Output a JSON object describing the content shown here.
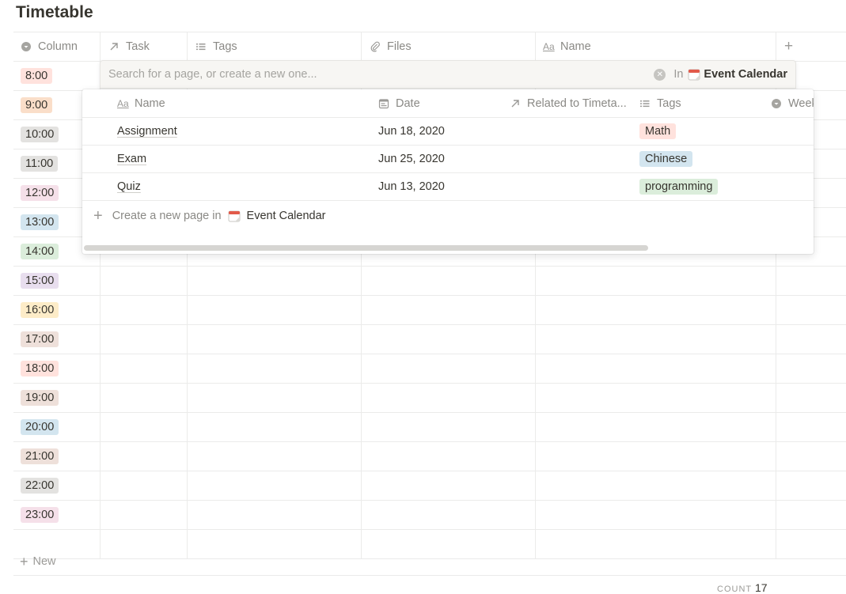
{
  "page": {
    "title": "Timetable"
  },
  "table": {
    "columns": [
      {
        "icon": "select-icon",
        "label": "Column"
      },
      {
        "icon": "relation-arrow-icon",
        "label": "Task"
      },
      {
        "icon": "list-icon",
        "label": "Tags"
      },
      {
        "icon": "paperclip-icon",
        "label": "Files"
      },
      {
        "icon": "text-aa-icon",
        "label": "Name"
      }
    ],
    "add_column": "+",
    "rows": [
      {
        "time": "8:00",
        "color": "#ffe2dd"
      },
      {
        "time": "9:00",
        "color": "#fadec9"
      },
      {
        "time": "10:00",
        "color": "#e3e2e0"
      },
      {
        "time": "11:00",
        "color": "#e3e2e0"
      },
      {
        "time": "12:00",
        "color": "#f5e0e9"
      },
      {
        "time": "13:00",
        "color": "#d3e5ef"
      },
      {
        "time": "14:00",
        "color": "#dbeddb"
      },
      {
        "time": "15:00",
        "color": "#e8deee"
      },
      {
        "time": "16:00",
        "color": "#fdecc8"
      },
      {
        "time": "17:00",
        "color": "#eee0da"
      },
      {
        "time": "18:00",
        "color": "#ffe2dd"
      },
      {
        "time": "19:00",
        "color": "#eee0da"
      },
      {
        "time": "20:00",
        "color": "#d3e5ef"
      },
      {
        "time": "21:00",
        "color": "#eee0da"
      },
      {
        "time": "22:00",
        "color": "#e3e2e0"
      },
      {
        "time": "23:00",
        "color": "#f5e0e9"
      },
      {
        "time": "",
        "color": ""
      }
    ],
    "new_label": "New",
    "count_label": "COUNT",
    "count_value": "17"
  },
  "search": {
    "placeholder": "Search for a page, or create a new one...",
    "in_label": "In",
    "database": "Event Calendar"
  },
  "popup": {
    "columns": [
      {
        "icon": "text-aa-icon",
        "label": "Name"
      },
      {
        "icon": "calendar-icon",
        "label": "Date"
      },
      {
        "icon": "relation-arrow-icon",
        "label": "Related to Timeta..."
      },
      {
        "icon": "list-icon",
        "label": "Tags"
      },
      {
        "icon": "select-icon",
        "label": "Week"
      }
    ],
    "rows": [
      {
        "name": "Assignment",
        "date": "Jun 18, 2020",
        "tag": "Math",
        "tag_color": "#ffe2dd"
      },
      {
        "name": "Exam",
        "date": "Jun 25, 2020",
        "tag": "Chinese",
        "tag_color": "#d3e5ef"
      },
      {
        "name": "Quiz",
        "date": "Jun 13, 2020",
        "tag": "programming",
        "tag_color": "#dbeddb"
      }
    ],
    "create_label": "Create a new page in",
    "create_db": "Event Calendar"
  }
}
